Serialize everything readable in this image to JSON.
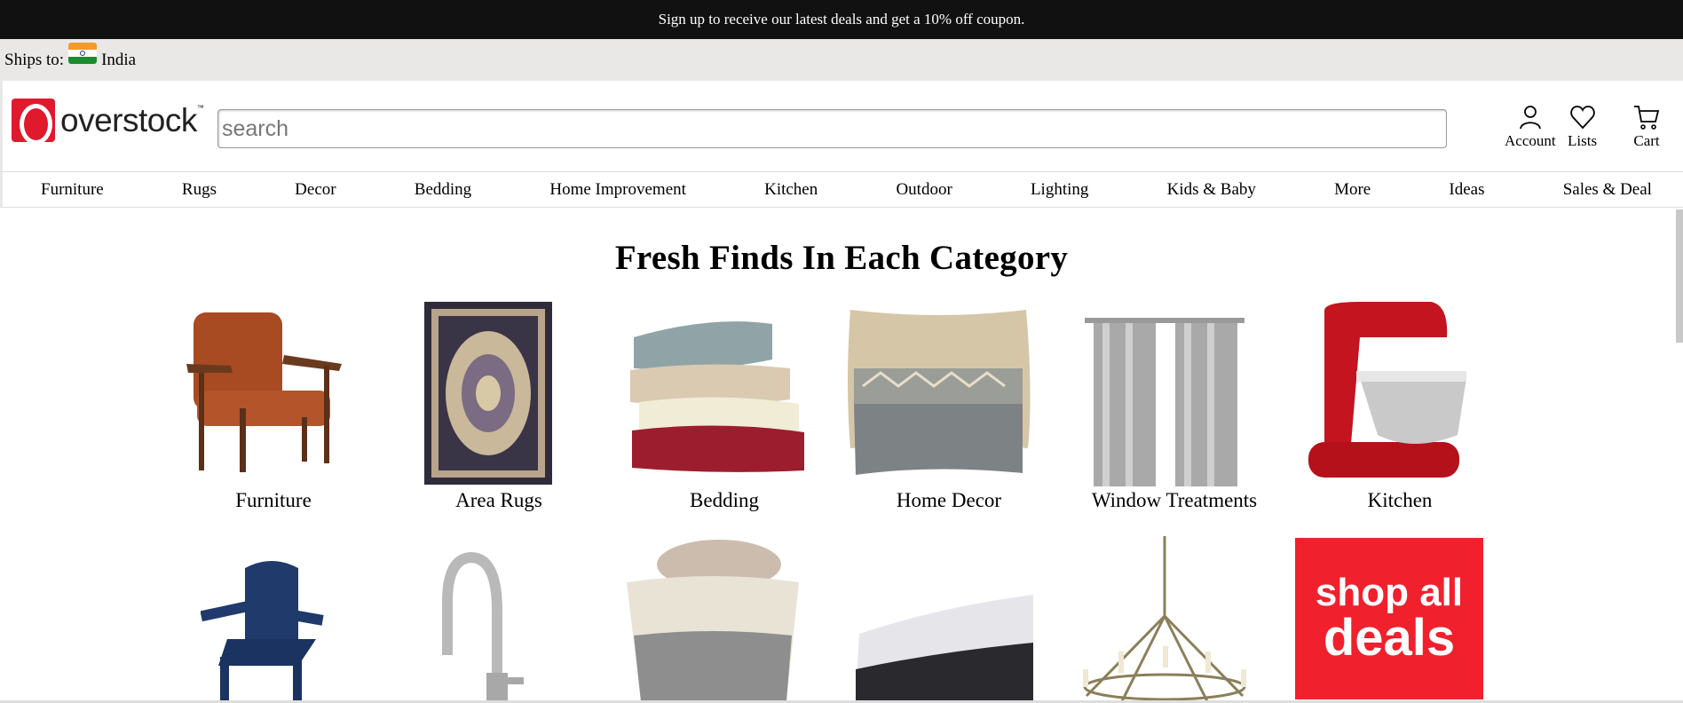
{
  "promo": {
    "text": "Sign up to receive our latest deals and get a 10% off coupon."
  },
  "ships": {
    "label": "Ships to:",
    "country": "India"
  },
  "header": {
    "logo_text": "overstock",
    "logo_tm": "™",
    "search_placeholder": "search",
    "account_label": "Account",
    "lists_label": "Lists",
    "cart_label": "Cart"
  },
  "nav": {
    "items": [
      "Furniture",
      "Rugs",
      "Decor",
      "Bedding",
      "Home Improvement",
      "Kitchen",
      "Outdoor",
      "Lighting",
      "Kids & Baby",
      "More",
      "Ideas",
      "Sales & Deal"
    ]
  },
  "main": {
    "title": "Fresh Finds In Each Category",
    "categories": [
      {
        "label": "Furniture",
        "icon": "armchair-image"
      },
      {
        "label": "Area Rugs",
        "icon": "rug-image"
      },
      {
        "label": "Bedding",
        "icon": "blankets-image"
      },
      {
        "label": "Home Decor",
        "icon": "pillow-image"
      },
      {
        "label": "Window Treatments",
        "icon": "curtains-image"
      },
      {
        "label": "Kitchen",
        "icon": "stand-mixer-image"
      }
    ],
    "row2": [
      {
        "icon": "adirondack-chair-image"
      },
      {
        "icon": "kitchen-faucet-image"
      },
      {
        "icon": "storage-basket-image"
      },
      {
        "icon": "mattress-image"
      },
      {
        "icon": "chandelier-image"
      }
    ],
    "deals_tile": {
      "line1": "shop all",
      "line2": "deals"
    }
  },
  "colors": {
    "brand_red": "#e0192d",
    "deals_red": "#f0202d",
    "promo_bg": "#111111",
    "ships_bg": "#e9e8e6"
  }
}
